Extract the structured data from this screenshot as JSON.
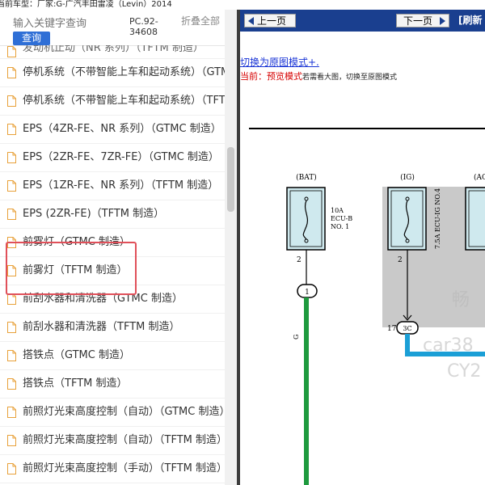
{
  "window": {
    "vehicle_label": "当前车型：厂家:G-广汽丰田雷凌（Levin）2014"
  },
  "left_panel": {
    "search_placeholder": "输入关键字查询",
    "query_button": "查询",
    "doc_id": "PC.92-34608",
    "collapse_all": "折叠全部",
    "partial_top_item": "发动机止动（NR 系列）（TFTM 制造）",
    "items": [
      "停机系统（不带智能上车和起动系统）（GTMC 制造）",
      "停机系统（不带智能上车和起动系统）（TFTM 制造）",
      "EPS（4ZR-FE、NR 系列）（GTMC 制造）",
      "EPS（2ZR-FE、7ZR-FE）（GTMC 制造）",
      "EPS（1ZR-FE、NR 系列）（TFTM 制造）",
      "EPS (2ZR-FE)（TFTM 制造）",
      "前雾灯（GTMC 制造）",
      "前雾灯（TFTM 制造）",
      "前刮水器和清洗器（GTMC 制造）",
      "前刮水器和清洗器（TFTM 制造）",
      "搭铁点（GTMC 制造）",
      "搭铁点（TFTM 制造）",
      "前照灯光束高度控制（自动）（GTMC 制造）",
      "前照灯光束高度控制（自动）（TFTM 制造）",
      "前照灯光束高度控制（手动）（TFTM 制造）"
    ],
    "highlighted_items": [
      "前雾灯（GTMC 制造）",
      "前雾灯（TFTM 制造）"
    ]
  },
  "right_panel": {
    "prev_button": "上一页",
    "next_button": "下一页",
    "refresh_button": "[刷新",
    "mode_link": "切换为原图模式+.",
    "mode_status_prefix": "当前：预览模式",
    "mode_status_hint": "若需看大图，切换至原图模式"
  },
  "diagram": {
    "bat_label": "(BAT)",
    "ig_label": "(IG)",
    "acc_label": "(AC",
    "fuse1_text": [
      "10A",
      "ECU-B",
      "NO. 1"
    ],
    "fuse2_text": "7.5A ECU-IG NO.4",
    "pin1": "2",
    "pin2": "2",
    "connector1": "1",
    "connector2": "3C",
    "connector2_pin": "17",
    "wire_color": "G",
    "watermark": [
      "畅",
      "car38",
      "CY2"
    ]
  },
  "colors": {
    "nav_bar": "#1a3f8f",
    "highlight_box": "#e0505a",
    "wire_green": "#1e9a3e",
    "wire_blue": "#1b9fd6",
    "fuse_box": "#cfe9ee"
  }
}
